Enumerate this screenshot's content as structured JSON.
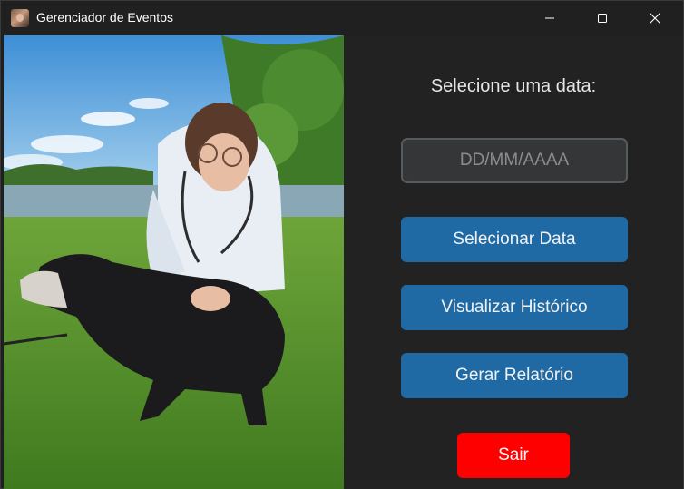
{
  "window": {
    "title": "Gerenciador de Eventos",
    "controls": [
      "minimize-icon",
      "maximize-icon",
      "close-icon"
    ]
  },
  "photo": {
    "description_icon": "photo-image"
  },
  "panel": {
    "prompt": "Selecione uma data:",
    "date_input": {
      "value": "",
      "placeholder": "DD/MM/AAAA"
    },
    "buttons": {
      "select_date": "Selecionar Data",
      "view_history": "Visualizar Histórico",
      "generate_report": "Gerar Relatório",
      "exit": "Sair"
    }
  },
  "colors": {
    "accent_blue": "#1f6aa5",
    "exit_red": "#ff0000",
    "panel_bg": "#222222",
    "input_bg": "#343638"
  }
}
